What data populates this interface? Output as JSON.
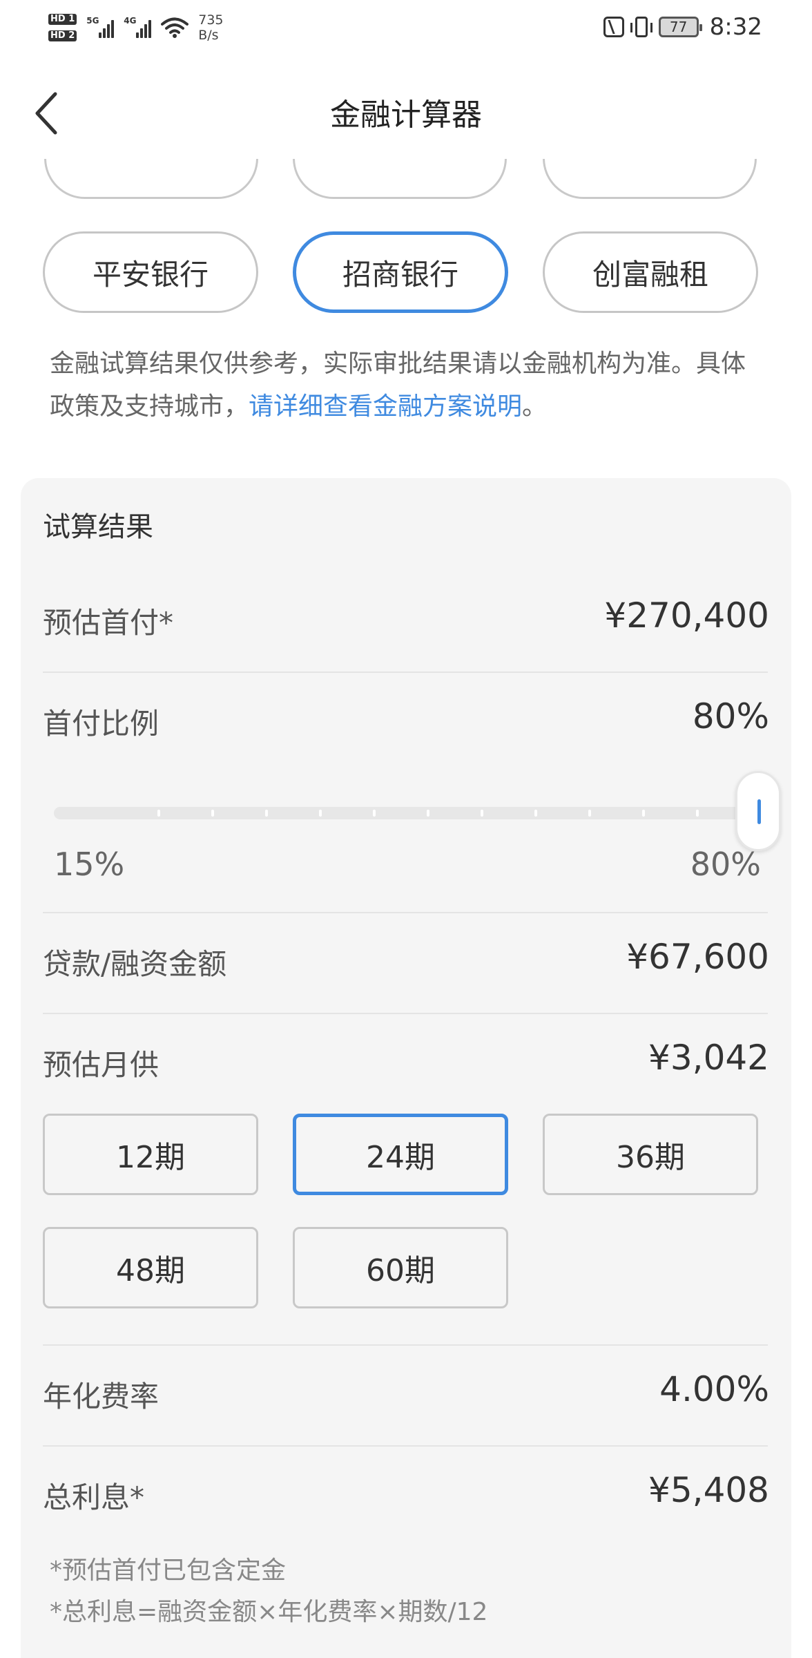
{
  "status_bar": {
    "sim1": "HD 1",
    "sim2": "HD 2",
    "sig1_label": "5G",
    "sig2_label": "4G",
    "net_speed": "735",
    "net_unit": "B/s",
    "battery": "77",
    "time": "8:32"
  },
  "header": {
    "title": "金融计算器"
  },
  "orgs": [
    "平安银行",
    "招商银行",
    "创富融租"
  ],
  "notice": {
    "text": "金融试算结果仅供参考，实际审批结果请以金融机构为准。具体政策及支持城市，",
    "link": "请详细查看金融方案说明",
    "end": "。"
  },
  "result": {
    "title": "试算结果",
    "down_payment_label": "预估首付*",
    "down_payment_value": "¥270,400",
    "ratio_label": "首付比例",
    "ratio_value": "80%",
    "ratio_min": "15%",
    "ratio_max": "80%",
    "ratio_level": 1.0,
    "loan_label": "贷款/融资金额",
    "loan_value": "¥67,600",
    "monthly_label": "预估月供",
    "monthly_value": "¥3,042",
    "terms": [
      "12期",
      "24期",
      "36期",
      "48期",
      "60期"
    ],
    "selected_term": "24期",
    "rate_label": "年化费率",
    "rate_value": "4.00%",
    "interest_label": "总利息*",
    "interest_value": "¥5,408",
    "footnote1": "*预估首付已包含定金",
    "footnote2": "*总利息=融资金额×年化费率×期数/12"
  },
  "colors": {
    "accent": "#3f8ae0",
    "card_bg": "#f5f5f5"
  }
}
